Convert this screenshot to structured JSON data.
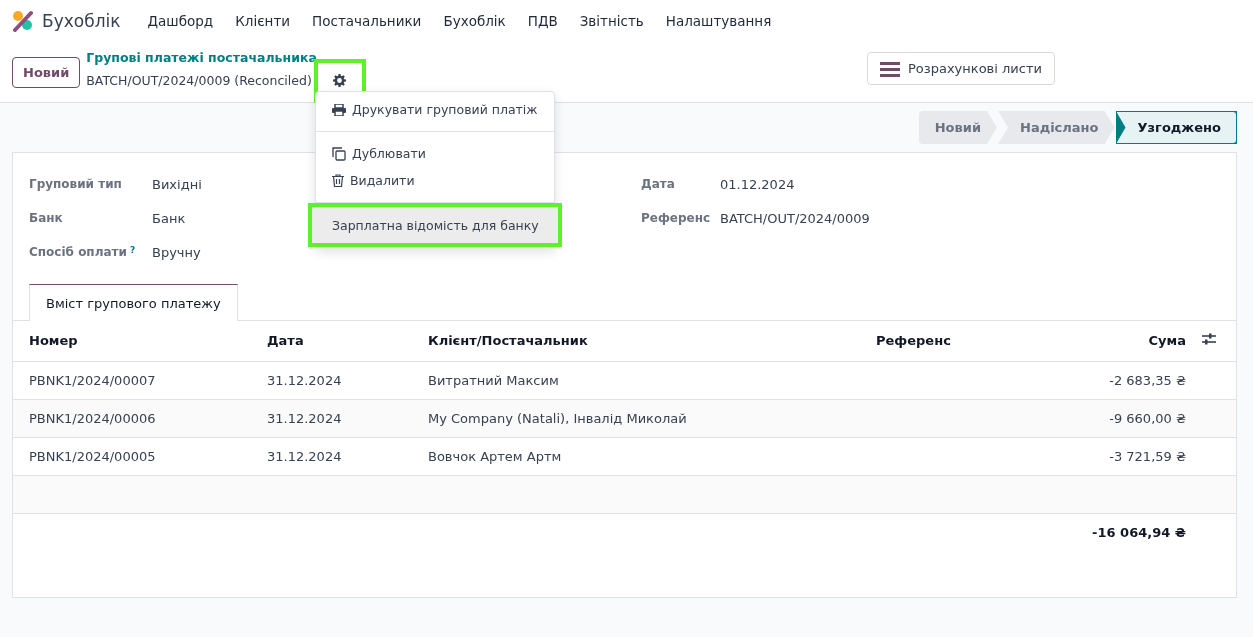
{
  "app": {
    "name": "Бухоблік"
  },
  "menu": [
    "Дашборд",
    "Клієнти",
    "Постачальники",
    "Бухоблік",
    "ПДВ",
    "Звітність",
    "Налаштування"
  ],
  "control_panel": {
    "new_button": "Новий",
    "breadcrumb": "Групові платежі постачальника",
    "record": "BATCH/OUT/2024/0009 (Reconciled)",
    "gear_highlighted": true,
    "smart_button": "Розрахункові листи"
  },
  "actions_menu": {
    "items": [
      {
        "kind": "print",
        "label": "Друкувати груповий платіж",
        "highlighted": false
      },
      {
        "kind": "divider"
      },
      {
        "kind": "duplicate",
        "label": "Дублювати",
        "highlighted": false
      },
      {
        "kind": "delete",
        "label": "Видалити",
        "highlighted": false
      },
      {
        "kind": "divider"
      },
      {
        "kind": "action",
        "label": "Зарплатна відомість для банку",
        "highlighted": true
      }
    ]
  },
  "stages": [
    {
      "label": "Новий",
      "selected": false
    },
    {
      "label": "Надіслано",
      "selected": false
    },
    {
      "label": "Узгоджено",
      "selected": true
    }
  ],
  "fields_left": [
    {
      "label": "Груповий тип",
      "value": "Вихідні"
    },
    {
      "label": "Банк",
      "value": "Банк"
    },
    {
      "label": "Спосіб оплати",
      "value": "Вручну",
      "help_mark": "?"
    }
  ],
  "fields_right": [
    {
      "label": "Дата",
      "value": "01.12.2024"
    },
    {
      "label": "Референс",
      "value": "BATCH/OUT/2024/0009"
    }
  ],
  "tabs": [
    {
      "label": "Вміст групового платежу",
      "selected": true
    }
  ],
  "table": {
    "columns": [
      "Номер",
      "Дата",
      "Клієнт/Постачальник",
      "Референс",
      "Сума"
    ],
    "rows": [
      [
        "PBNK1/2024/00007",
        "31.12.2024",
        "Витратний Максим",
        "",
        "-2 683,35 ₴"
      ],
      [
        "PBNK1/2024/00006",
        "31.12.2024",
        "My Company (Natali), Інвалід Миколай",
        "",
        "-9 660,00 ₴"
      ],
      [
        "PBNK1/2024/00005",
        "31.12.2024",
        "Вовчок Артем Артм",
        "",
        "-3 721,59 ₴"
      ]
    ],
    "total": "-16 064,94 ₴"
  }
}
